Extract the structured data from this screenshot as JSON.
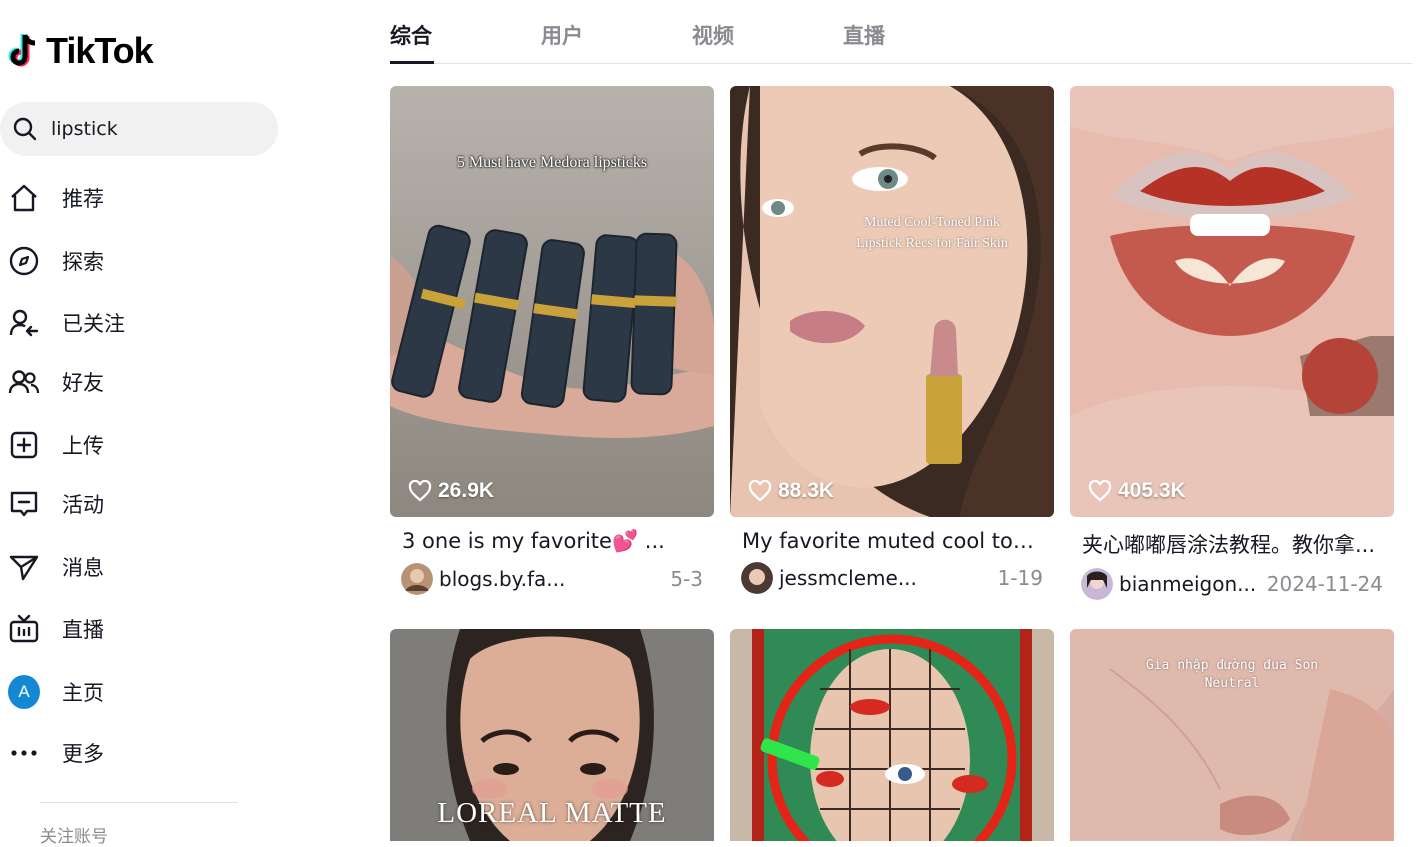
{
  "app": {
    "name": "TikTok"
  },
  "search": {
    "value": "lipstick"
  },
  "nav": [
    {
      "label": "推荐",
      "icon": "home-icon"
    },
    {
      "label": "探索",
      "icon": "compass-icon"
    },
    {
      "label": "已关注",
      "icon": "following-icon"
    },
    {
      "label": "好友",
      "icon": "friends-icon"
    },
    {
      "label": "上传",
      "icon": "upload-icon"
    },
    {
      "label": "活动",
      "icon": "activity-icon"
    },
    {
      "label": "消息",
      "icon": "messages-icon"
    },
    {
      "label": "直播",
      "icon": "live-icon"
    },
    {
      "label": "主页",
      "icon": "profile-avatar",
      "avatar_letter": "A"
    },
    {
      "label": "更多",
      "icon": "more-icon"
    }
  ],
  "following_section": {
    "title": "关注账号"
  },
  "tabs": [
    {
      "label": "综合",
      "active": true
    },
    {
      "label": "用户",
      "active": false
    },
    {
      "label": "视频",
      "active": false
    },
    {
      "label": "直播",
      "active": false
    }
  ],
  "videos": [
    {
      "likes": "26.9K",
      "caption": "3 one is my favorite💕 ...",
      "author": "blogs.by.fa...",
      "date": "5-3",
      "overlay": "5 Must have Medora lipsticks"
    },
    {
      "likes": "88.3K",
      "caption": "My favorite muted cool tone...",
      "author": "jessmcleme...",
      "date": "1-19",
      "overlay": "Muted Cool-Toned Pink Lipstick Recs for Fair Skin"
    },
    {
      "likes": "405.3K",
      "caption": "夹心嘟嘟唇涂法教程。教你拿...",
      "author": "bianmeigon...",
      "date": "2024-11-24",
      "overlay": ""
    },
    {
      "overlay": "LOREAL MATTE"
    },
    {
      "overlay": ""
    },
    {
      "overlay": "Gia nhập đường đua Son Neutral"
    }
  ],
  "colors": {
    "accent": "#fe2c55",
    "text": "#161823",
    "muted": "#8a8b91",
    "avatar_bg": "#1588d4"
  }
}
